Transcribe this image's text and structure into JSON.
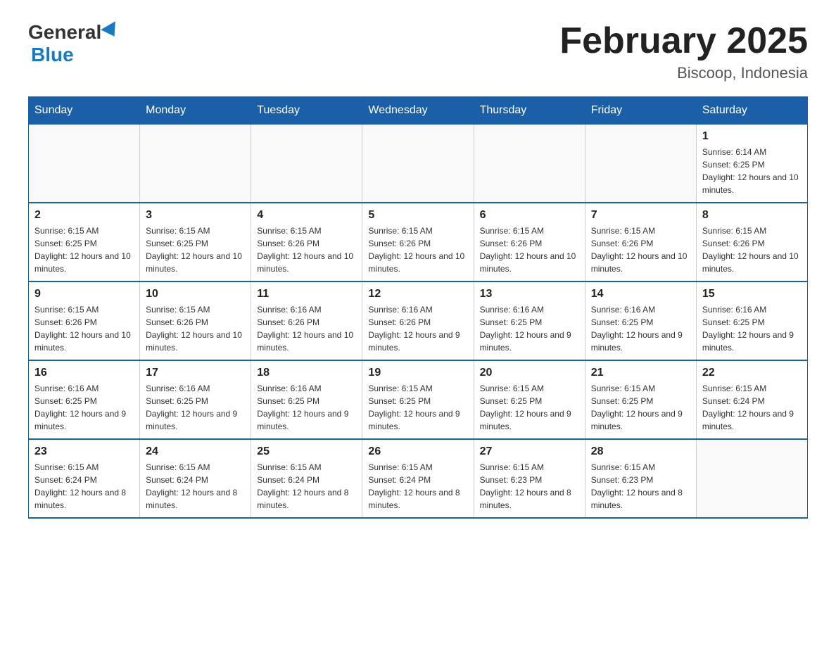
{
  "header": {
    "logo_general": "General",
    "logo_blue": "Blue",
    "title": "February 2025",
    "subtitle": "Biscoop, Indonesia"
  },
  "weekdays": [
    "Sunday",
    "Monday",
    "Tuesday",
    "Wednesday",
    "Thursday",
    "Friday",
    "Saturday"
  ],
  "weeks": [
    [
      {
        "day": "",
        "sunrise": "",
        "sunset": "",
        "daylight": ""
      },
      {
        "day": "",
        "sunrise": "",
        "sunset": "",
        "daylight": ""
      },
      {
        "day": "",
        "sunrise": "",
        "sunset": "",
        "daylight": ""
      },
      {
        "day": "",
        "sunrise": "",
        "sunset": "",
        "daylight": ""
      },
      {
        "day": "",
        "sunrise": "",
        "sunset": "",
        "daylight": ""
      },
      {
        "day": "",
        "sunrise": "",
        "sunset": "",
        "daylight": ""
      },
      {
        "day": "1",
        "sunrise": "Sunrise: 6:14 AM",
        "sunset": "Sunset: 6:25 PM",
        "daylight": "Daylight: 12 hours and 10 minutes."
      }
    ],
    [
      {
        "day": "2",
        "sunrise": "Sunrise: 6:15 AM",
        "sunset": "Sunset: 6:25 PM",
        "daylight": "Daylight: 12 hours and 10 minutes."
      },
      {
        "day": "3",
        "sunrise": "Sunrise: 6:15 AM",
        "sunset": "Sunset: 6:25 PM",
        "daylight": "Daylight: 12 hours and 10 minutes."
      },
      {
        "day": "4",
        "sunrise": "Sunrise: 6:15 AM",
        "sunset": "Sunset: 6:26 PM",
        "daylight": "Daylight: 12 hours and 10 minutes."
      },
      {
        "day": "5",
        "sunrise": "Sunrise: 6:15 AM",
        "sunset": "Sunset: 6:26 PM",
        "daylight": "Daylight: 12 hours and 10 minutes."
      },
      {
        "day": "6",
        "sunrise": "Sunrise: 6:15 AM",
        "sunset": "Sunset: 6:26 PM",
        "daylight": "Daylight: 12 hours and 10 minutes."
      },
      {
        "day": "7",
        "sunrise": "Sunrise: 6:15 AM",
        "sunset": "Sunset: 6:26 PM",
        "daylight": "Daylight: 12 hours and 10 minutes."
      },
      {
        "day": "8",
        "sunrise": "Sunrise: 6:15 AM",
        "sunset": "Sunset: 6:26 PM",
        "daylight": "Daylight: 12 hours and 10 minutes."
      }
    ],
    [
      {
        "day": "9",
        "sunrise": "Sunrise: 6:15 AM",
        "sunset": "Sunset: 6:26 PM",
        "daylight": "Daylight: 12 hours and 10 minutes."
      },
      {
        "day": "10",
        "sunrise": "Sunrise: 6:15 AM",
        "sunset": "Sunset: 6:26 PM",
        "daylight": "Daylight: 12 hours and 10 minutes."
      },
      {
        "day": "11",
        "sunrise": "Sunrise: 6:16 AM",
        "sunset": "Sunset: 6:26 PM",
        "daylight": "Daylight: 12 hours and 10 minutes."
      },
      {
        "day": "12",
        "sunrise": "Sunrise: 6:16 AM",
        "sunset": "Sunset: 6:26 PM",
        "daylight": "Daylight: 12 hours and 9 minutes."
      },
      {
        "day": "13",
        "sunrise": "Sunrise: 6:16 AM",
        "sunset": "Sunset: 6:25 PM",
        "daylight": "Daylight: 12 hours and 9 minutes."
      },
      {
        "day": "14",
        "sunrise": "Sunrise: 6:16 AM",
        "sunset": "Sunset: 6:25 PM",
        "daylight": "Daylight: 12 hours and 9 minutes."
      },
      {
        "day": "15",
        "sunrise": "Sunrise: 6:16 AM",
        "sunset": "Sunset: 6:25 PM",
        "daylight": "Daylight: 12 hours and 9 minutes."
      }
    ],
    [
      {
        "day": "16",
        "sunrise": "Sunrise: 6:16 AM",
        "sunset": "Sunset: 6:25 PM",
        "daylight": "Daylight: 12 hours and 9 minutes."
      },
      {
        "day": "17",
        "sunrise": "Sunrise: 6:16 AM",
        "sunset": "Sunset: 6:25 PM",
        "daylight": "Daylight: 12 hours and 9 minutes."
      },
      {
        "day": "18",
        "sunrise": "Sunrise: 6:16 AM",
        "sunset": "Sunset: 6:25 PM",
        "daylight": "Daylight: 12 hours and 9 minutes."
      },
      {
        "day": "19",
        "sunrise": "Sunrise: 6:15 AM",
        "sunset": "Sunset: 6:25 PM",
        "daylight": "Daylight: 12 hours and 9 minutes."
      },
      {
        "day": "20",
        "sunrise": "Sunrise: 6:15 AM",
        "sunset": "Sunset: 6:25 PM",
        "daylight": "Daylight: 12 hours and 9 minutes."
      },
      {
        "day": "21",
        "sunrise": "Sunrise: 6:15 AM",
        "sunset": "Sunset: 6:25 PM",
        "daylight": "Daylight: 12 hours and 9 minutes."
      },
      {
        "day": "22",
        "sunrise": "Sunrise: 6:15 AM",
        "sunset": "Sunset: 6:24 PM",
        "daylight": "Daylight: 12 hours and 9 minutes."
      }
    ],
    [
      {
        "day": "23",
        "sunrise": "Sunrise: 6:15 AM",
        "sunset": "Sunset: 6:24 PM",
        "daylight": "Daylight: 12 hours and 8 minutes."
      },
      {
        "day": "24",
        "sunrise": "Sunrise: 6:15 AM",
        "sunset": "Sunset: 6:24 PM",
        "daylight": "Daylight: 12 hours and 8 minutes."
      },
      {
        "day": "25",
        "sunrise": "Sunrise: 6:15 AM",
        "sunset": "Sunset: 6:24 PM",
        "daylight": "Daylight: 12 hours and 8 minutes."
      },
      {
        "day": "26",
        "sunrise": "Sunrise: 6:15 AM",
        "sunset": "Sunset: 6:24 PM",
        "daylight": "Daylight: 12 hours and 8 minutes."
      },
      {
        "day": "27",
        "sunrise": "Sunrise: 6:15 AM",
        "sunset": "Sunset: 6:23 PM",
        "daylight": "Daylight: 12 hours and 8 minutes."
      },
      {
        "day": "28",
        "sunrise": "Sunrise: 6:15 AM",
        "sunset": "Sunset: 6:23 PM",
        "daylight": "Daylight: 12 hours and 8 minutes."
      },
      {
        "day": "",
        "sunrise": "",
        "sunset": "",
        "daylight": ""
      }
    ]
  ]
}
